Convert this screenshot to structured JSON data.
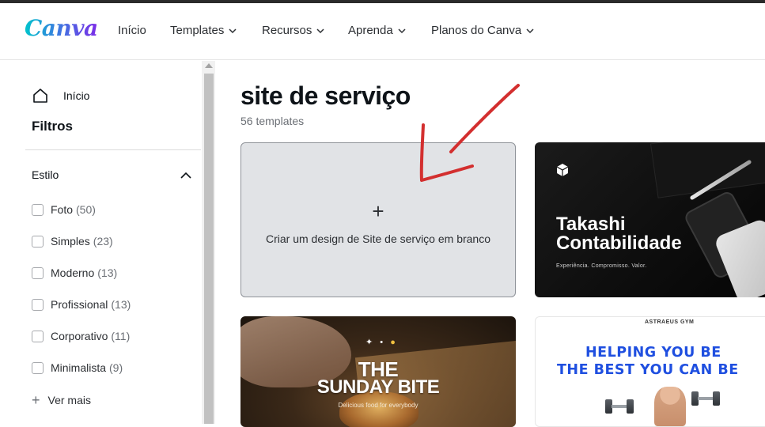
{
  "header": {
    "logo": "Canva",
    "nav": [
      {
        "label": "Início"
      },
      {
        "label": "Templates"
      },
      {
        "label": "Recursos"
      },
      {
        "label": "Aprenda"
      },
      {
        "label": "Planos do Canva"
      }
    ]
  },
  "sidebar": {
    "home_label": "Início",
    "filters_title": "Filtros",
    "style_section": "Estilo",
    "filters": [
      {
        "label": "Foto",
        "count": "(50)"
      },
      {
        "label": "Simples",
        "count": "(23)"
      },
      {
        "label": "Moderno",
        "count": "(13)"
      },
      {
        "label": "Profissional",
        "count": "(13)"
      },
      {
        "label": "Corporativo",
        "count": "(11)"
      },
      {
        "label": "Minimalista",
        "count": "(9)"
      }
    ],
    "more_label": "Ver mais"
  },
  "main": {
    "title": "site de serviço",
    "count": "56 templates",
    "blank_card": {
      "plus": "+",
      "label": "Criar um design de Site de serviço em branco"
    },
    "templates": [
      {
        "title_line1": "Takashi",
        "title_line2": "Contabilidade",
        "subtitle": "Experiência. Compromisso. Valor."
      },
      {
        "title_line1": "THE",
        "title_line2": "SUNDAY BITE",
        "subtitle": "Delicious food for everybody"
      },
      {
        "brand": "ASTRAEUS GYM",
        "line1": "HELPING YOU BE",
        "line2": "THE BEST YOU CAN BE"
      }
    ]
  },
  "colors": {
    "annotation_arrow": "#d32f2f",
    "gym_blue": "#1f4fe0",
    "blank_card_bg": "#e1e3e6"
  },
  "icons": [
    "home-icon",
    "chevron-down-icon",
    "chevron-up-icon",
    "plus-icon",
    "checkbox"
  ]
}
